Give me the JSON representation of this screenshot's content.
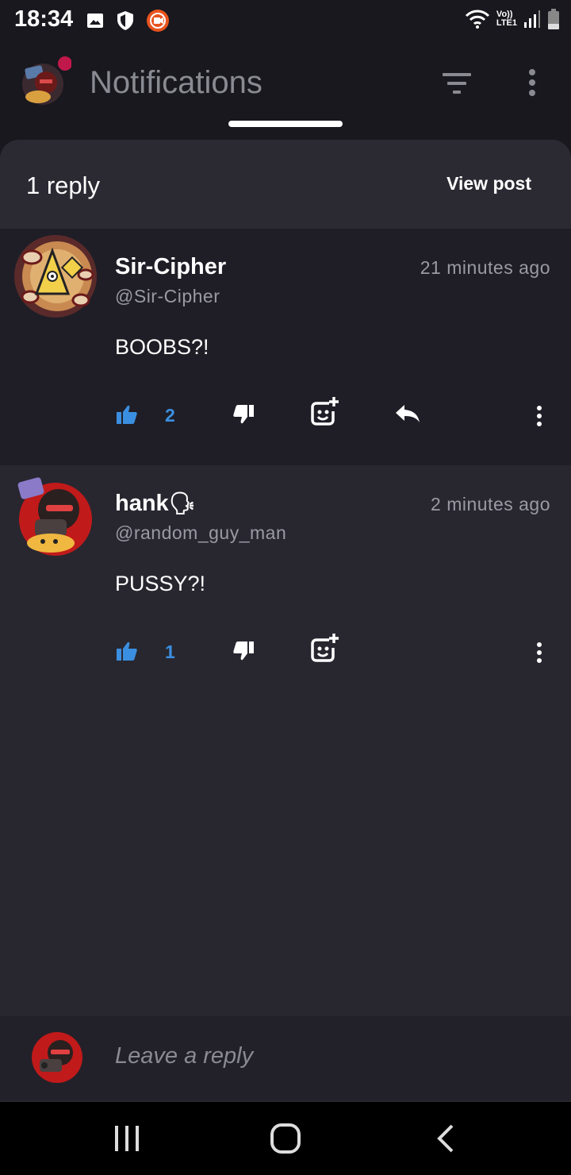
{
  "status_bar": {
    "time": "18:34",
    "network_label_top": "Vo))",
    "network_label_bottom": "LTE1",
    "icons_left": [
      "image-icon",
      "shield-icon",
      "recorder-icon"
    ],
    "icons_right": [
      "wifi-icon",
      "signal-icon",
      "battery-icon"
    ]
  },
  "header": {
    "title": "Notifications",
    "avatar_icon": "user-avatar",
    "filter_icon": "filter-icon",
    "more_icon": "more-vertical-icon",
    "notification_dot_color": "#c0184a"
  },
  "sheet": {
    "reply_count": "1 reply",
    "view_post": "View post"
  },
  "comments": [
    {
      "name": "Sir-Cipher",
      "handle": "@Sir-Cipher",
      "time": "21 minutes ago",
      "body": "BOOBS?!",
      "likes": "2",
      "has_reply_action": true
    },
    {
      "name": "hank",
      "name_emoji": "🗣",
      "handle": "@random_guy_man",
      "time": "2 minutes ago",
      "body": "PUSSY?!",
      "likes": "1",
      "has_reply_action": false
    }
  ],
  "reply_bar": {
    "placeholder": "Leave a reply"
  },
  "nav_bar": {
    "buttons": [
      "recents-icon",
      "home-icon",
      "back-icon"
    ]
  },
  "colors": {
    "accent_blue": "#3b8fe0",
    "background": "#18181e",
    "sheet": "#282730",
    "muted_text": "#9a9aa3"
  }
}
